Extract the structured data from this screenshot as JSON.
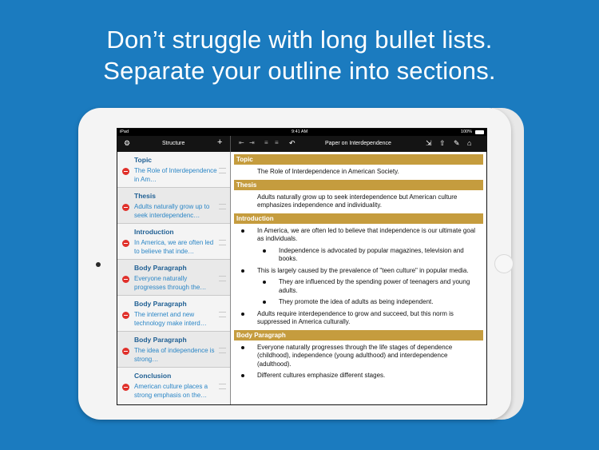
{
  "headline": {
    "line1": "Don’t struggle with long bullet lists.",
    "line2": "Separate your outline into sections."
  },
  "colors": {
    "background": "#1b7bbf",
    "section_header": "#c59c3e",
    "delete": "#e0302a",
    "sidebar_title": "#1f5f93",
    "sidebar_desc": "#2b86c6"
  },
  "statusbar": {
    "device": "iPad",
    "time": "9:41 AM",
    "battery": "100%"
  },
  "toolbar": {
    "sidebar_title": "Structure",
    "document_title": "Paper on Interdependence",
    "icons": [
      "gear-icon",
      "add-icon",
      "outdent-icon",
      "indent-icon",
      "move-up-icon",
      "move-down-icon",
      "undo-icon",
      "export-icon",
      "share-icon",
      "tools-icon",
      "home-icon"
    ]
  },
  "sidebar": {
    "items": [
      {
        "title": "Topic",
        "desc": "The Role of Interdependence in Am…"
      },
      {
        "title": "Thesis",
        "desc": "Adults naturally grow up to seek interdependenc…"
      },
      {
        "title": "Introduction",
        "desc": "In America, we are often led to believe that inde…"
      },
      {
        "title": "Body Paragraph",
        "desc": "Everyone naturally progresses through the…"
      },
      {
        "title": "Body Paragraph",
        "desc": "The internet and new technology make interd…"
      },
      {
        "title": "Body Paragraph",
        "desc": "The idea of independence is strong…"
      },
      {
        "title": "Conclusion",
        "desc": "American culture places a strong emphasis on the…"
      }
    ]
  },
  "document": {
    "topic_header": "Topic",
    "topic_text": "The Role of Interdependence in American Society.",
    "thesis_header": "Thesis",
    "thesis_text": "Adults naturally grow up to seek interdependence but American culture emphasizes independence and individuality.",
    "intro_header": "Introduction",
    "intro_b1": "In America, we are often led to believe that independence is our ultimate goal as individuals.",
    "intro_b1a": "Independence is advocated by popular magazines, television and books.",
    "intro_b2": "This is largely caused by the prevalence of \"teen culture\" in popular media.",
    "intro_b2a": "They are influenced by the spending power of teenagers and young adults.",
    "intro_b2b": "They promote the idea of adults as being independent.",
    "intro_b3": "Adults require interdependence to grow and succeed, but this norm is suppressed in America culturally.",
    "body_header": "Body Paragraph",
    "body_b1": "Everyone naturally progresses through the life stages of dependence (childhood), independence (young adulthood) and interdependence (adulthood).",
    "body_b2": "Different cultures emphasize different stages."
  }
}
